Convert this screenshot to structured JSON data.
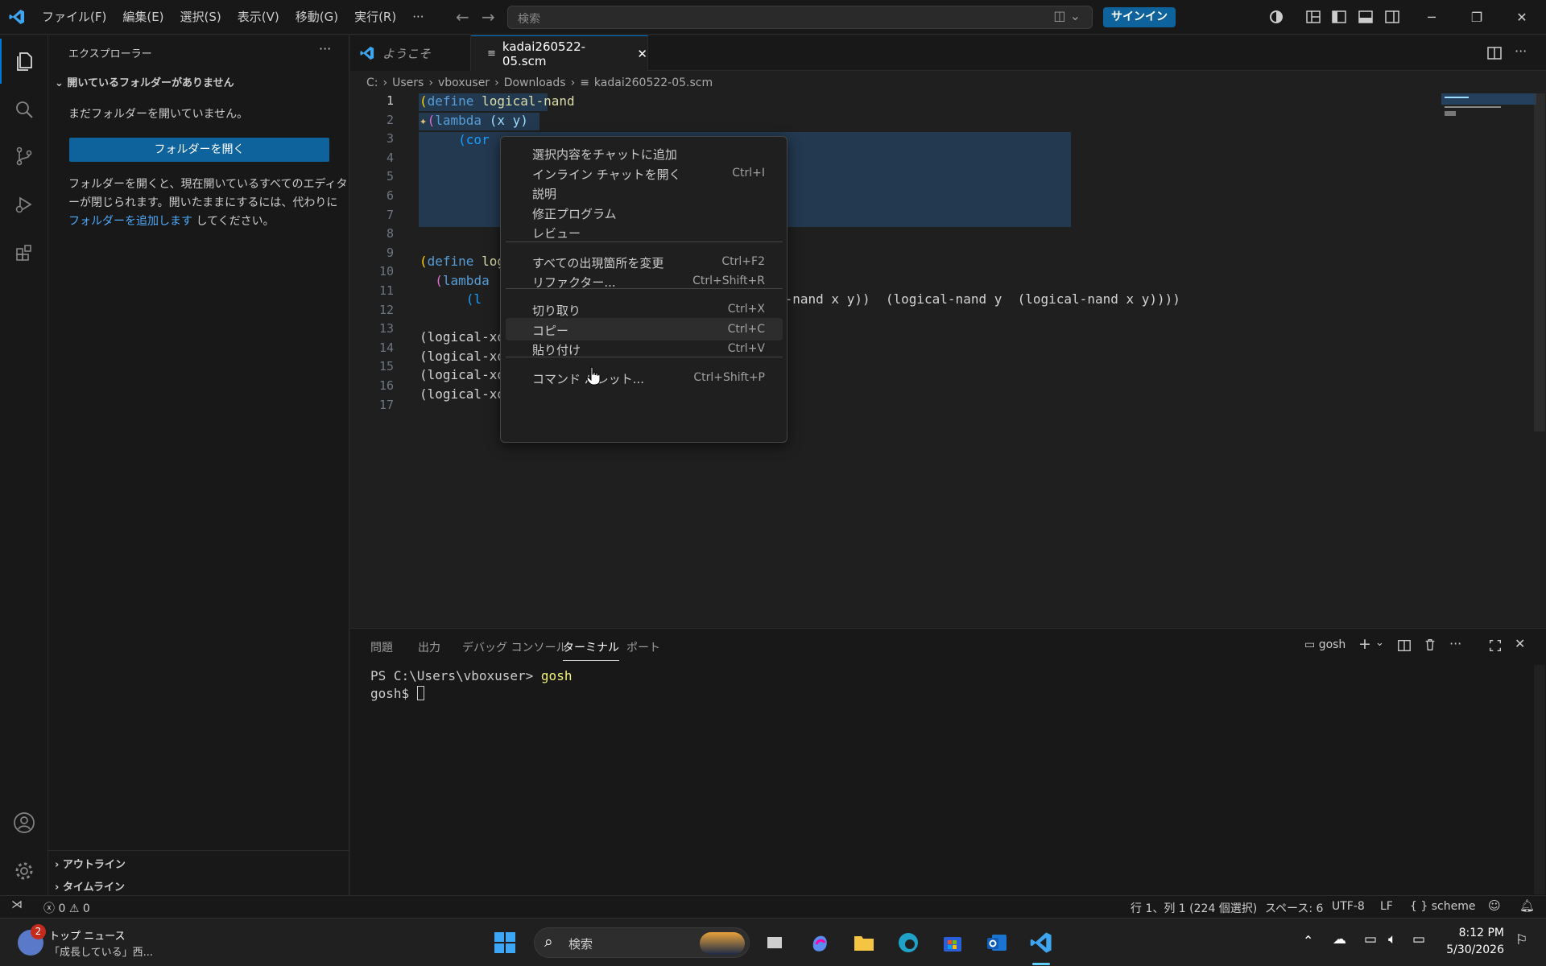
{
  "titlebar": {
    "menus": [
      "ファイル(F)",
      "編集(E)",
      "選択(S)",
      "表示(V)",
      "移動(G)",
      "実行(R)",
      "···"
    ],
    "search_placeholder": "検索",
    "signin": "サインイン"
  },
  "sidebar": {
    "title": "エクスプローラー",
    "section_no_folder": "開いているフォルダーがありません",
    "no_folder_msg": "まだフォルダーを開いていません。",
    "open_folder_button": "フォルダーを開く",
    "info_line1": "フォルダーを開くと、現在開いているすべてのエディタ",
    "info_line2": "ーが閉じられます。開いたままにするには、代わりに",
    "info_link": "フォルダーを追加します",
    "info_tail": " してください。",
    "outline": "アウトライン",
    "timeline": "タイムライン"
  },
  "tabs": [
    {
      "label": "ようこそ"
    },
    {
      "label": "kadai260522-05.scm"
    }
  ],
  "breadcrumb": [
    "C:",
    "Users",
    "vboxuser",
    "Downloads",
    "kadai260522-05.scm"
  ],
  "code": {
    "line_numbers": [
      "1",
      "2",
      "3",
      "4",
      "5",
      "6",
      "7",
      "8",
      "9",
      "10",
      "11",
      "12",
      "13",
      "14",
      "15",
      "16",
      "17"
    ],
    "l1_a": "(",
    "l1_b": "define",
    "l1_c": " logical-nand",
    "l2_a": " (",
    "l2_b": "lambda",
    "l2_c": " (x y)",
    "l3": "     (cor",
    "l9_a": "(",
    "l9_b": "define",
    "l9_c": " log",
    "l10_a": "  (",
    "l10_b": "lambda",
    "l11_a": "      (l",
    "l11_b": "l-nand x y))  (logical-nand y  (logical-nand x y))))",
    "l13": "(logical-xo",
    "l14": "(logical-xo",
    "l15": "(logical-xo",
    "l16": "(logical-xo"
  },
  "context_menu": {
    "items": [
      {
        "label": "選択内容をチャットに追加",
        "key": ""
      },
      {
        "label": "インライン チャットを開く",
        "key": "Ctrl+I"
      },
      {
        "label": "説明",
        "key": ""
      },
      {
        "label": "修正プログラム",
        "key": ""
      },
      {
        "label": "レビュー",
        "key": ""
      },
      {
        "label": "すべての出現箇所を変更",
        "key": "Ctrl+F2"
      },
      {
        "label": "リファクター...",
        "key": "Ctrl+Shift+R"
      },
      {
        "label": "切り取り",
        "key": "Ctrl+X"
      },
      {
        "label": "コピー",
        "key": "Ctrl+C"
      },
      {
        "label": "貼り付け",
        "key": "Ctrl+V"
      },
      {
        "label": "コマンド パレット...",
        "key": "Ctrl+Shift+P"
      }
    ]
  },
  "panel": {
    "tabs": [
      "問題",
      "出力",
      "デバッグ コンソール",
      "ターミナル",
      "ポート"
    ],
    "terminal_name": "gosh",
    "term_line1_prompt": "PS C:\\Users\\vboxuser> ",
    "term_line1_cmd": "gosh",
    "term_line2": "gosh$ "
  },
  "statusbar": {
    "errors": "0",
    "warnings": "0",
    "position": "行 1、列 1 (224 個選択)",
    "spaces": "スペース: 6",
    "encoding": "UTF-8",
    "eol": "LF",
    "language": "scheme"
  },
  "taskbar": {
    "news_badge": "2",
    "news_title": "トップ ニュース",
    "news_sub": "「成長している」西...",
    "search": "検索",
    "time": "8:12 PM",
    "date": "5/30/2026"
  },
  "colors": {
    "accent": "#0078d4",
    "button": "#0e639c",
    "editor_bg": "#1f1f1f",
    "chrome_bg": "#181818"
  }
}
